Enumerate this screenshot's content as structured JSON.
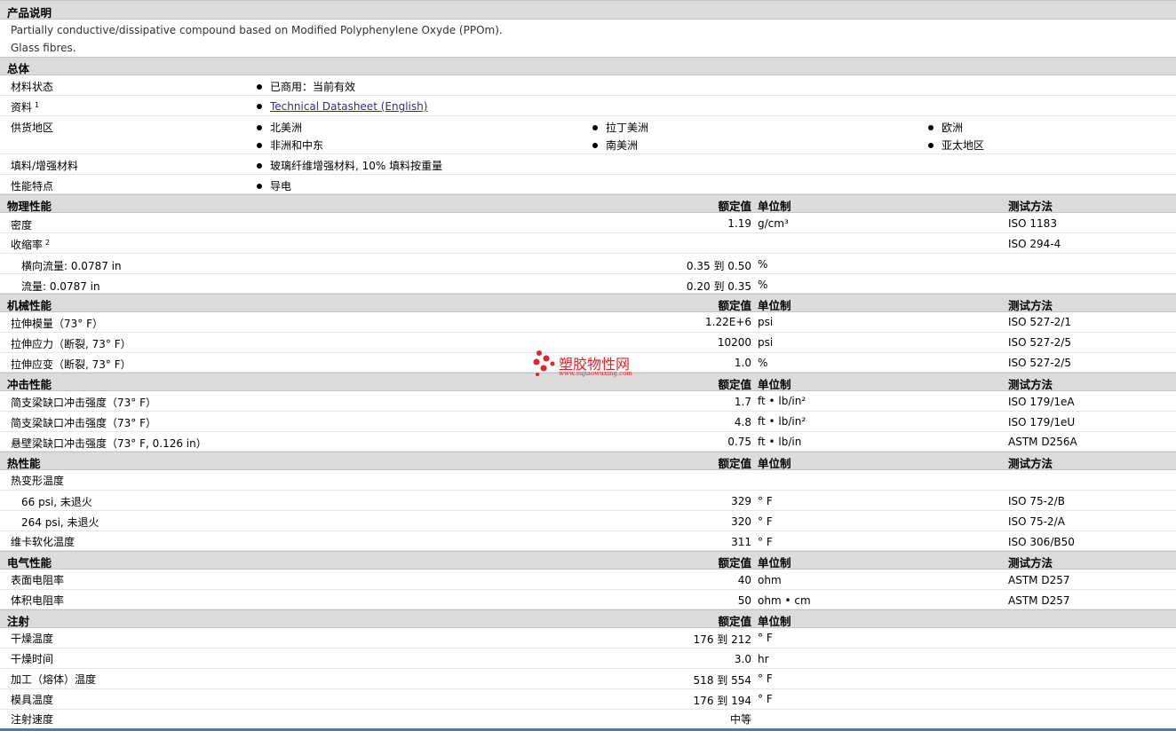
{
  "desc_section": {
    "title": "产品说明",
    "lines": [
      "Partially conductive/dissipative compound based on Modified Polyphenylene Oxyde (PPOm).",
      "Glass fibres."
    ]
  },
  "general": {
    "title": "总体",
    "material_status": {
      "label": "材料状态",
      "value": "已商用：当前有效"
    },
    "literature": {
      "label": "资料",
      "sup": "1",
      "link": "Technical Datasheet (English)"
    },
    "availability": {
      "label": "供货地区",
      "items": [
        "北美洲",
        "拉丁美洲",
        "欧洲",
        "非洲和中东",
        "南美洲",
        "亚太地区"
      ]
    },
    "filler": {
      "label": "填料/增强材料",
      "value": "玻璃纤维增强材料, 10% 填料按重量"
    },
    "features": {
      "label": "性能特点",
      "value": "导电"
    }
  },
  "headers": {
    "value": "额定值",
    "unit": "单位制",
    "test": "测试方法"
  },
  "physical": {
    "title": "物理性能",
    "rows": [
      {
        "label": "密度",
        "value": "1.19",
        "unit": "g/cm³",
        "test": "ISO 1183"
      },
      {
        "label": "收缩率",
        "sup": "2",
        "value": "",
        "unit": "",
        "test": "ISO 294-4"
      },
      {
        "label": "横向流量: 0.0787 in",
        "value": "0.35 到  0.50",
        "unit": "%",
        "test": ""
      },
      {
        "label": "流量: 0.0787 in",
        "value": "0.20 到  0.35",
        "unit": "%",
        "test": ""
      }
    ]
  },
  "mechanical": {
    "title": "机械性能",
    "rows": [
      {
        "label": "拉伸模量（73°  F）",
        "value": "1.22E+6",
        "unit": "psi",
        "test": "ISO 527-2/1"
      },
      {
        "label": "拉伸应力（断裂, 73°  F）",
        "value": "10200",
        "unit": "psi",
        "test": "ISO 527-2/5"
      },
      {
        "label": "拉伸应变（断裂, 73°  F）",
        "value": "1.0",
        "unit": "%",
        "test": "ISO 527-2/5"
      }
    ]
  },
  "impact": {
    "title": "冲击性能",
    "rows": [
      {
        "label": "简支梁缺口冲击强度（73°  F）",
        "value": "1.7",
        "unit": "ft • lb/in²",
        "test": "ISO 179/1eA"
      },
      {
        "label": "简支梁缺口冲击强度（73°  F）",
        "value": "4.8",
        "unit": "ft • lb/in²",
        "test": "ISO 179/1eU"
      },
      {
        "label": "悬壁梁缺口冲击强度（73°  F, 0.126 in）",
        "value": "0.75",
        "unit": "ft • lb/in",
        "test": "ASTM D256A"
      }
    ]
  },
  "thermal": {
    "title": "热性能",
    "rows": [
      {
        "label": "热变形温度",
        "value": "",
        "unit": "",
        "test": ""
      },
      {
        "label": "66 psi, 未退火",
        "value": "329",
        "unit": "°  F",
        "test": "ISO 75-2/B"
      },
      {
        "label": "264 psi, 未退火",
        "value": "320",
        "unit": "°  F",
        "test": "ISO 75-2/A"
      },
      {
        "label": "维卡软化温度",
        "value": "311",
        "unit": "°  F",
        "test": "ISO 306/B50"
      }
    ]
  },
  "electrical": {
    "title": "电气性能",
    "rows": [
      {
        "label": "表面电阻率",
        "value": "40",
        "unit": "ohm",
        "test": "ASTM D257"
      },
      {
        "label": "体积电阻率",
        "value": "50",
        "unit": "ohm • cm",
        "test": "ASTM D257"
      }
    ]
  },
  "injection": {
    "title": "注射",
    "rows": [
      {
        "label": "干燥温度",
        "value": "176 到  212",
        "unit": "°  F"
      },
      {
        "label": "干燥时间",
        "value": "3.0",
        "unit": "hr"
      },
      {
        "label": "加工（熔体）温度",
        "value": "518 到  554",
        "unit": "°  F"
      },
      {
        "label": "模具温度",
        "value": "176 到  194",
        "unit": "°  F"
      },
      {
        "label": "注射速度",
        "value": "中等",
        "unit": ""
      }
    ]
  },
  "watermark": {
    "title": "塑胶物性网",
    "url": "www.sujiaowuxing.com",
    "brand_color": "#e0242b"
  }
}
